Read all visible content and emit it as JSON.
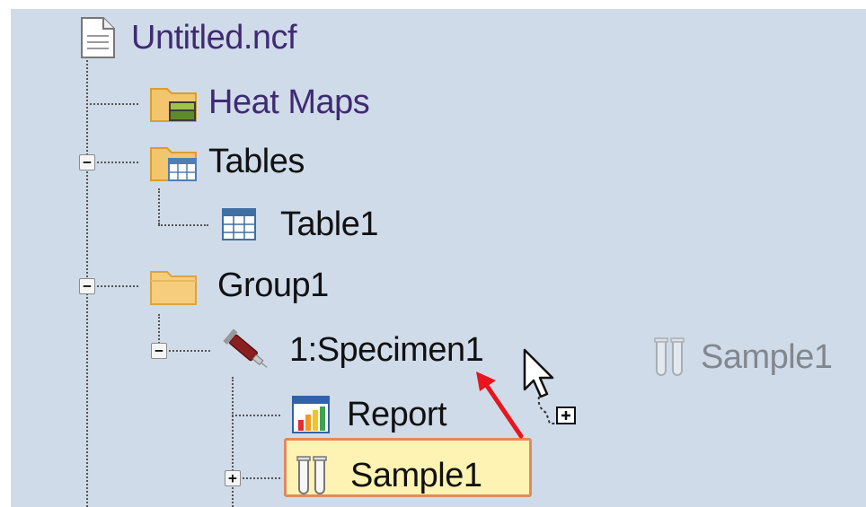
{
  "tree": {
    "file": {
      "label": "Untitled.ncf",
      "icon": "document-icon"
    },
    "heat_maps": {
      "label": "Heat Maps",
      "icon": "heatmap-folder-icon"
    },
    "tables": {
      "label": "Tables",
      "icon": "table-folder-icon",
      "toggle": "−"
    },
    "table1": {
      "label": "Table1",
      "icon": "table-icon"
    },
    "group1": {
      "label": "Group1",
      "icon": "folder-icon",
      "toggle": "−"
    },
    "specimen1": {
      "label": "1:Specimen1",
      "icon": "syringe-icon",
      "toggle": "−"
    },
    "report": {
      "label": "Report",
      "icon": "report-chart-icon"
    },
    "sample1": {
      "label": "Sample1",
      "icon": "test-tubes-icon",
      "toggle": "+",
      "selected": true
    }
  },
  "drag": {
    "ghost_label": "Sample1",
    "ghost_icon": "test-tubes-icon",
    "cursor_icon": "drag-copy-cursor-icon",
    "hint_arrow_icon": "red-arrow-icon",
    "hint_color": "#e8141e"
  },
  "colors": {
    "panel_background": "#cfdbe9",
    "selection_fill": "#fef3b2",
    "selection_border": "#e2895d",
    "label_accent": "#3f2a73"
  }
}
